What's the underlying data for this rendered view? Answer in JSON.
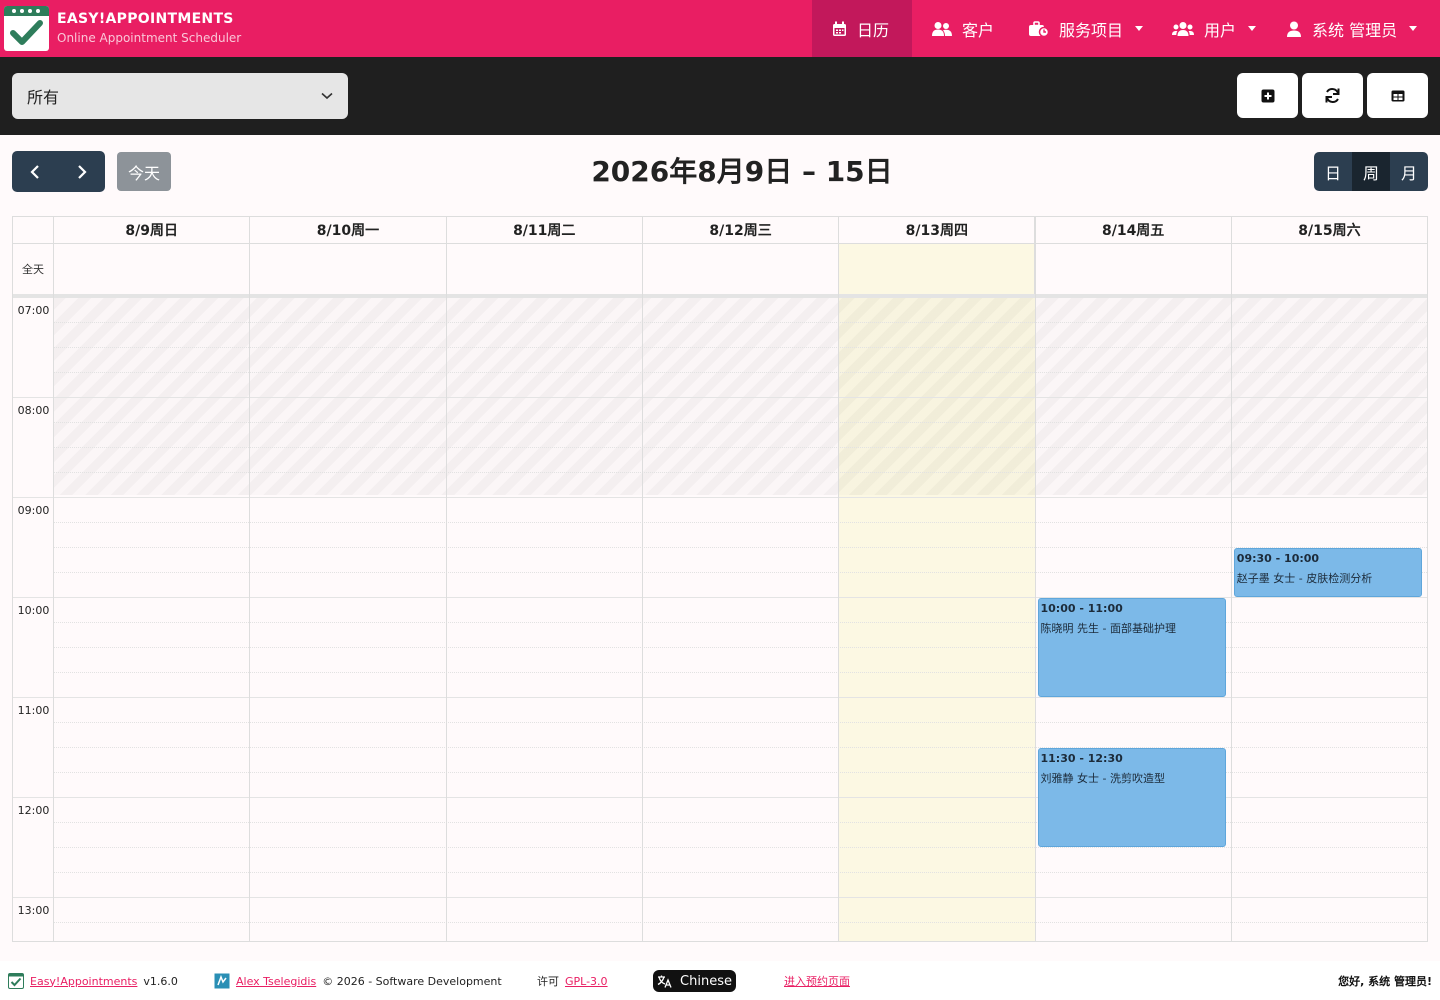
{
  "brand": {
    "title": "EASY!APPOINTMENTS",
    "subtitle": "Online Appointment Scheduler"
  },
  "nav": [
    {
      "label": "日历",
      "icon": "calendar-icon",
      "active": true,
      "dropdown": false
    },
    {
      "label": "客户",
      "icon": "users-icon",
      "active": false,
      "dropdown": false
    },
    {
      "label": "服务项目",
      "icon": "briefcase-icon",
      "active": false,
      "dropdown": true
    },
    {
      "label": "用户",
      "icon": "user-group-icon",
      "active": false,
      "dropdown": true
    },
    {
      "label": "系统 管理员",
      "icon": "user-icon",
      "active": false,
      "dropdown": true
    }
  ],
  "toolbar": {
    "filter_value": "所有",
    "buttons": [
      {
        "name": "add-appointment-button",
        "icon": "plus-square-icon"
      },
      {
        "name": "reload-button",
        "icon": "reload-icon"
      },
      {
        "name": "table-view-button",
        "icon": "table-icon"
      }
    ]
  },
  "calendar": {
    "today_label": "今天",
    "title": "2026年8月9日 – 15日",
    "views": [
      {
        "label": "日",
        "active": false
      },
      {
        "label": "周",
        "active": true
      },
      {
        "label": "月",
        "active": false
      }
    ],
    "allday_label": "全天",
    "days": [
      "8/9周日",
      "8/10周一",
      "8/11周二",
      "8/12周三",
      "8/13周四",
      "8/14周五",
      "8/15周六"
    ],
    "today_index": 4,
    "times": [
      "07:00",
      "08:00",
      "09:00",
      "10:00",
      "11:00",
      "12:00",
      "13:00"
    ],
    "events": [
      {
        "day": 6,
        "start": "09:30",
        "end": "10:00",
        "time_label": "09:30 - 10:00",
        "title": "赵子墨 女士 - 皮肤检测分析"
      },
      {
        "day": 5,
        "start": "10:00",
        "end": "11:00",
        "time_label": "10:00 - 11:00",
        "title": "陈晓明 先生 - 面部基础护理"
      },
      {
        "day": 5,
        "start": "11:30",
        "end": "12:30",
        "time_label": "11:30 - 12:30",
        "title": "刘雅静 女士 - 洗剪吹造型"
      }
    ],
    "colors": {
      "event_bg": "#7cb9e8",
      "today_bg": "#fcf8e3",
      "brand": "#e91e63"
    }
  },
  "footer": {
    "app_link": "Easy!Appointments",
    "version": "v1.6.0",
    "author_link": "Alex Tselegidis",
    "copyright": "© 2026 - Software Development",
    "license_label": "许可",
    "license_link": "GPL-3.0",
    "language": "Chinese",
    "booking_link": "进入预约页面",
    "greeting": "您好, 系统 管理员!"
  }
}
